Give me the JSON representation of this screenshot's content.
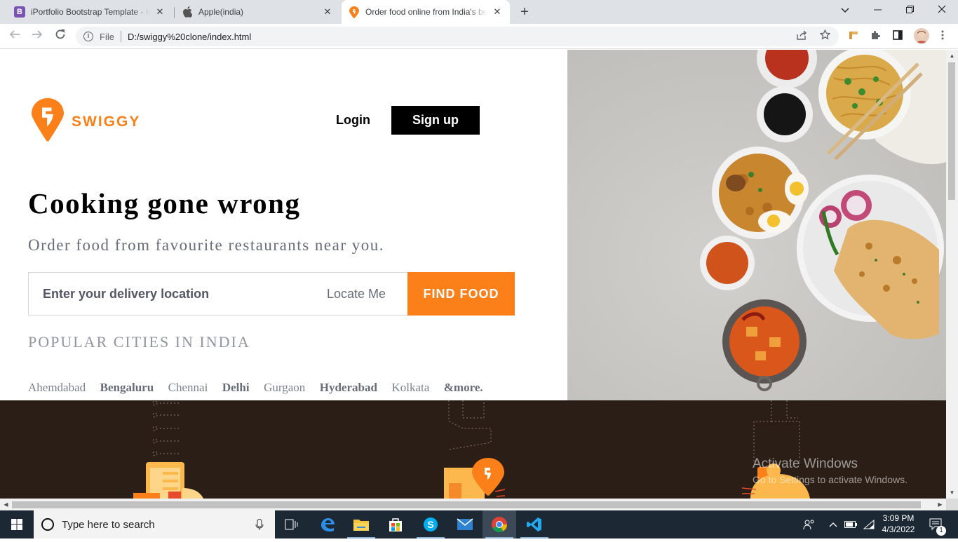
{
  "browser": {
    "tabs": [
      {
        "title": "iPortfolio Bootstrap Template - In",
        "favicon": "bootstrap-icon"
      },
      {
        "title": "Apple(india)",
        "favicon": "apple-icon"
      },
      {
        "title": "Order food online from India's be",
        "favicon": "swiggy-icon"
      }
    ],
    "new_tab_label": "+",
    "address": {
      "scheme_label": "File",
      "url": "D:/swiggy%20clone/index.html"
    }
  },
  "page": {
    "brand": {
      "name": "SWIGGY",
      "color": "#fc8019"
    },
    "nav": {
      "login": "Login",
      "signup": "Sign up"
    },
    "hero": {
      "headline": "Cooking gone wrong",
      "subline": "Order food from favourite restaurants near you.",
      "search": {
        "placeholder": "Enter your delivery location",
        "locate": "Locate Me",
        "button": "FIND FOOD"
      }
    },
    "cities": {
      "title": "POPULAR CITIES IN INDIA",
      "items": [
        "Ahemdabad",
        "Bengaluru",
        "Chennai",
        "Delhi",
        "Gurgaon",
        "Hyderabad",
        "Kolkata",
        "&more."
      ]
    }
  },
  "watermark": {
    "line1": "Activate Windows",
    "line2": "Go to Settings to activate Windows."
  },
  "taskbar": {
    "search_placeholder": "Type here to search",
    "time": "3:09 PM",
    "date": "4/3/2022",
    "notification_count": "1"
  }
}
